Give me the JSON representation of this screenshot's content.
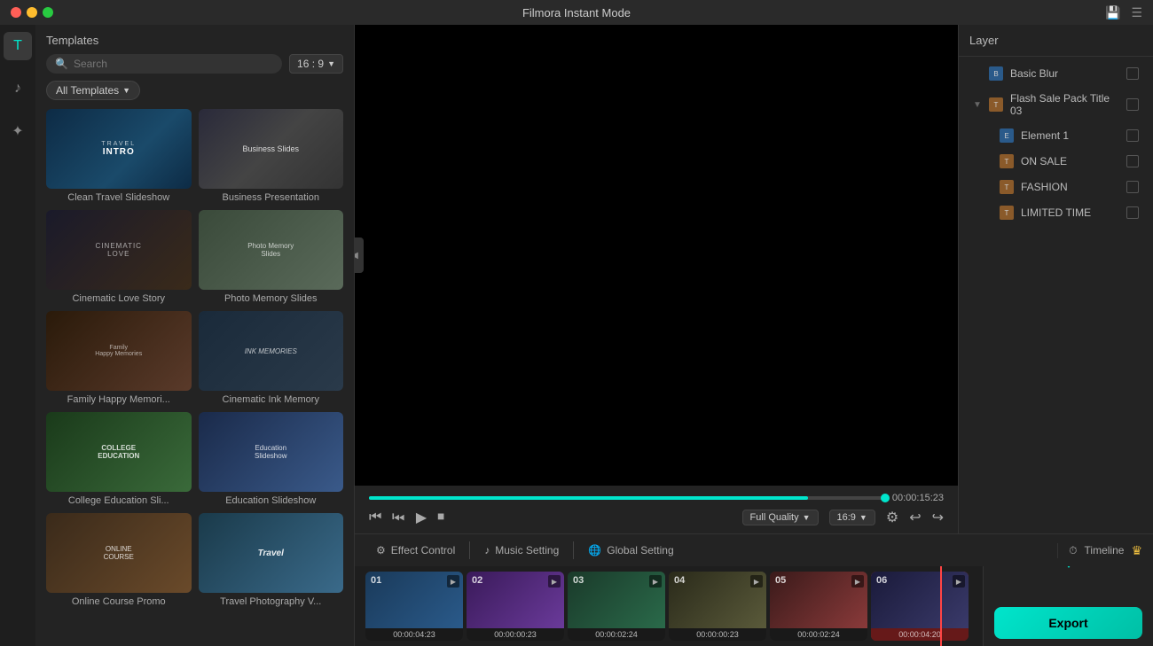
{
  "app": {
    "title": "Filmora Instant Mode"
  },
  "sidebar": {
    "icons": [
      {
        "name": "text-icon",
        "symbol": "T",
        "active": true
      },
      {
        "name": "music-icon",
        "symbol": "♪",
        "active": false
      },
      {
        "name": "effects-icon",
        "symbol": "✦",
        "active": false
      }
    ]
  },
  "templates": {
    "title": "Templates",
    "search_placeholder": "Search",
    "ratio": "16 : 9",
    "filter_label": "All Templates",
    "items": [
      {
        "id": 1,
        "label": "Clean Travel Slideshow",
        "thumb_class": "thumb-travel",
        "col": "left"
      },
      {
        "id": 2,
        "label": "Business Presentation",
        "thumb_class": "thumb-business",
        "col": "right"
      },
      {
        "id": 3,
        "label": "Cinematic Love Story",
        "thumb_class": "thumb-cinematic",
        "col": "left"
      },
      {
        "id": 4,
        "label": "Photo Memory Slides",
        "thumb_class": "thumb-photo",
        "col": "right"
      },
      {
        "id": 5,
        "label": "Family Happy Memori...",
        "thumb_class": "thumb-family",
        "col": "left"
      },
      {
        "id": 6,
        "label": "Cinematic Ink Memory",
        "thumb_class": "thumb-ink",
        "col": "right"
      },
      {
        "id": 7,
        "label": "College Education Sli...",
        "thumb_class": "thumb-college",
        "col": "left"
      },
      {
        "id": 8,
        "label": "Education Slideshow",
        "thumb_class": "thumb-education",
        "col": "right"
      },
      {
        "id": 9,
        "label": "Online Course Promo",
        "thumb_class": "thumb-online",
        "col": "left"
      },
      {
        "id": 10,
        "label": "Travel Photography V...",
        "thumb_class": "thumb-travel2",
        "col": "right"
      }
    ]
  },
  "preview": {
    "time_display": "00:00:15:23",
    "quality": "Full Quality",
    "ratio": "16:9"
  },
  "controls": {
    "rewind": "⏮",
    "step_back": "⏭",
    "play": "▶",
    "stop": "⏹"
  },
  "tabs": [
    {
      "id": "effect",
      "label": "Effect Control",
      "icon": "⚙"
    },
    {
      "id": "music",
      "label": "Music Setting",
      "icon": "♪"
    },
    {
      "id": "global",
      "label": "Global Setting",
      "icon": "🌐"
    }
  ],
  "timeline": {
    "label": "Timeline",
    "clips": [
      {
        "num": "01",
        "time": "00:00:04:23",
        "color": "clip-1"
      },
      {
        "num": "02",
        "time": "00:00:00:23",
        "color": "clip-2"
      },
      {
        "num": "03",
        "time": "00:00:02:24",
        "color": "clip-3"
      },
      {
        "num": "04",
        "time": "00:00:00:23",
        "color": "clip-4"
      },
      {
        "num": "05",
        "time": "00:00:02:24",
        "color": "clip-5"
      },
      {
        "num": "06",
        "time": "00:00:04:20",
        "color": "clip-6"
      }
    ]
  },
  "layers": {
    "title": "Layer",
    "items": [
      {
        "id": "basic-blur",
        "label": "Basic Blur",
        "icon": "B",
        "icon_class": "blue",
        "expanded": false,
        "indent": 0
      },
      {
        "id": "flash-sale",
        "label": "Flash Sale Pack Title 03",
        "icon": "T",
        "icon_class": "orange",
        "expanded": true,
        "indent": 0
      },
      {
        "id": "element-1",
        "label": "Element 1",
        "icon": "E",
        "icon_class": "blue",
        "expanded": false,
        "indent": 1
      },
      {
        "id": "on-sale",
        "label": "ON SALE",
        "icon": "T",
        "icon_class": "orange",
        "expanded": false,
        "indent": 1
      },
      {
        "id": "fashion",
        "label": "FASHION",
        "icon": "T",
        "icon_class": "orange",
        "expanded": false,
        "indent": 1
      },
      {
        "id": "limited-time",
        "label": "LIMITED TIME",
        "icon": "T",
        "icon_class": "orange",
        "expanded": false,
        "indent": 1
      }
    ]
  },
  "export": {
    "label": "Export"
  }
}
